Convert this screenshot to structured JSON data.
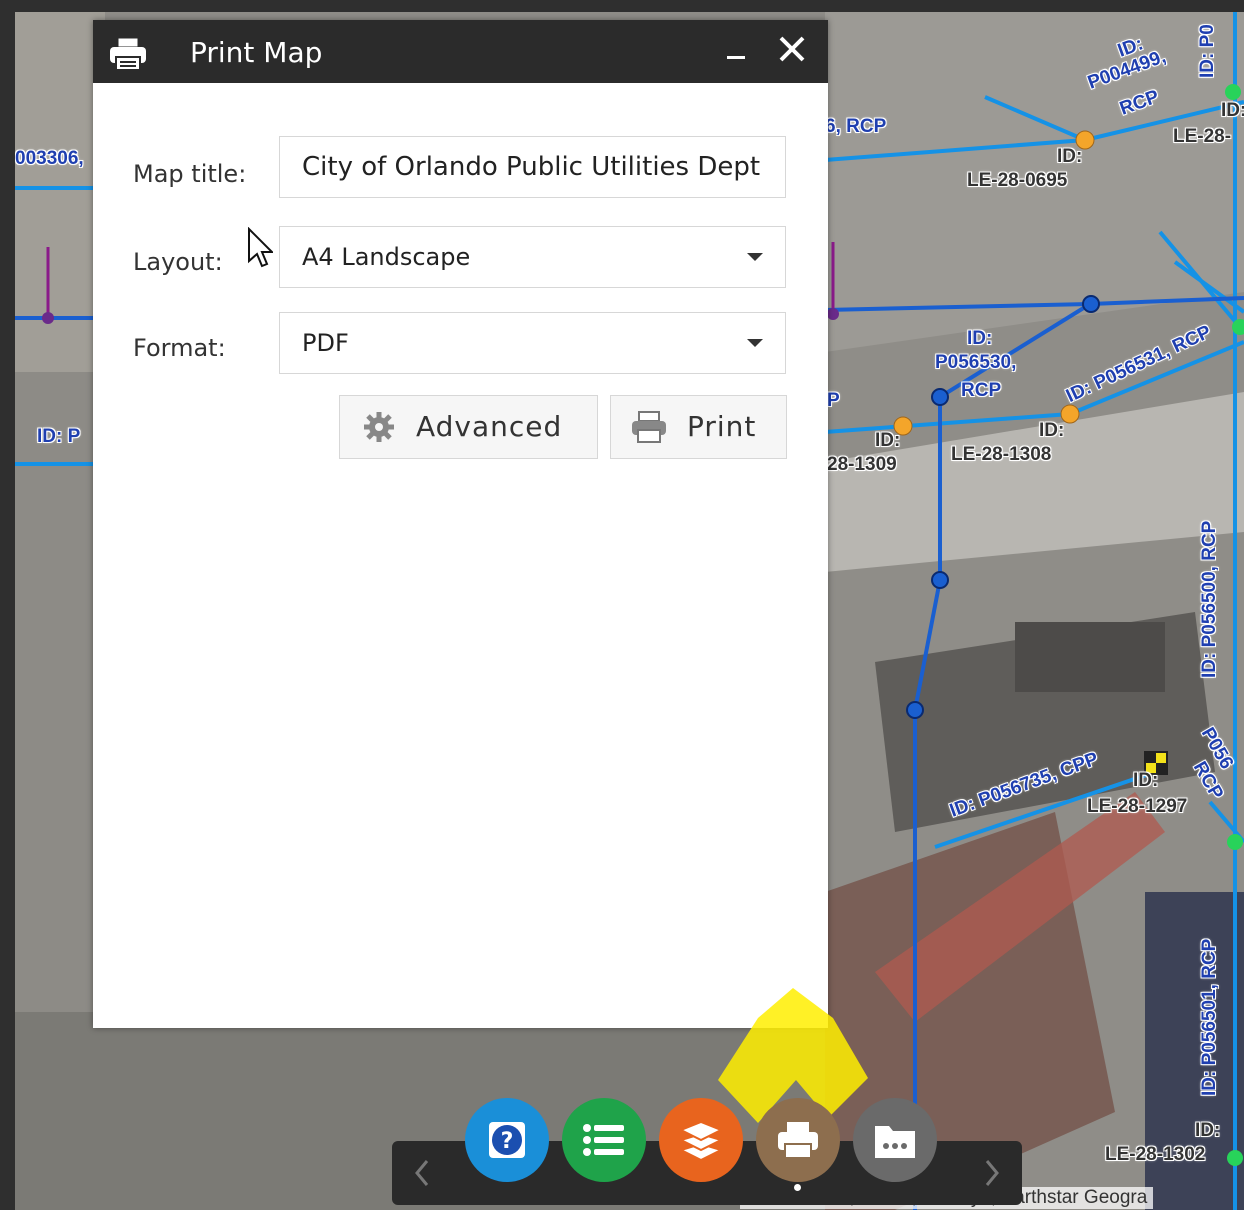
{
  "panel": {
    "title": "Print Map",
    "icon": "printer-icon",
    "map_title_label": "Map title:",
    "map_title_value": "City of Orlando Public Utilities Dept",
    "layout_label": "Layout:",
    "layout_value": "A4 Landscape",
    "format_label": "Format:",
    "format_value": "PDF",
    "advanced_label": "Advanced",
    "print_label": "Print"
  },
  "toolbar": {
    "buttons": [
      {
        "name": "help-button",
        "icon": "question-icon",
        "color": "#1a8fd8"
      },
      {
        "name": "legend-button",
        "icon": "list-icon",
        "color": "#1fa34a"
      },
      {
        "name": "layers-button",
        "icon": "layers-icon",
        "color": "#e8641e"
      },
      {
        "name": "print-button",
        "icon": "printer-icon",
        "color": "#8d6e4e"
      },
      {
        "name": "more-button",
        "icon": "folder-more-icon",
        "color": "#6a6a6a"
      }
    ]
  },
  "map": {
    "labels": [
      "003306,",
      "ID: P",
      "ID:",
      "P004499,",
      "RCP",
      "ID: P0",
      "ID:",
      "LE-28-",
      "6, RCP",
      "ID:",
      "LE-28-0695",
      "ID:",
      "P056530,",
      "RCP",
      "ID: P056531, RCP",
      "P",
      "ID:",
      "28-1309",
      "ID:",
      "LE-28-1308",
      "ID: P056500, RCP",
      "ID: P056735, CPP",
      "ID:",
      "LE-28-1297",
      "P056",
      "RCP",
      "ID: P056501, RCP",
      "ID:",
      "LE-28-1302"
    ],
    "attribution": "Source: Esri, Maxar, GeoEye, Earthstar Geogra"
  },
  "colors": {
    "header_bg": "#2b2b2b",
    "pipe_blue": "#1592e6",
    "node_blue": "#1a5fd0",
    "manhole_orange": "#f4a52a",
    "highlight_yellow": "#ffef00"
  }
}
